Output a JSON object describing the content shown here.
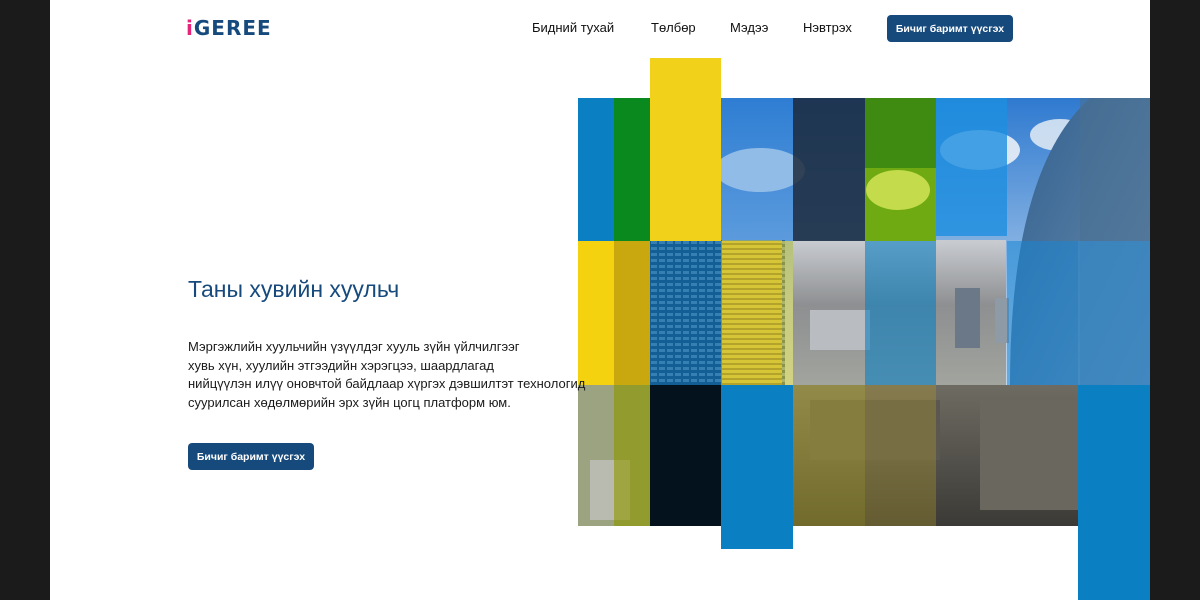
{
  "brand": {
    "logo_prefix": "i",
    "logo_rest": "GEREE"
  },
  "nav": {
    "items": [
      {
        "label": "Бидний тухай"
      },
      {
        "label": "Төлбөр"
      },
      {
        "label": "Мэдээ"
      },
      {
        "label": "Нэвтрэх"
      }
    ],
    "cta_label": "Бичиг баримт үүсгэх"
  },
  "hero": {
    "title": "Таны хувийн хуульч",
    "description_lines": [
      "Мэргэжлийн хуульчийн үзүүлдэг хууль зүйн үйлчилгээг",
      "хувь хүн, хуулийн этгээдийн хэрэгцээ, шаардлагад",
      "нийцүүлэн илүү оновчтой байдлаар хүргэх дэвшилтэт технологид",
      "суурилсан хөдөлмөрийн эрх зүйн цогц платформ юм."
    ],
    "cta_label": "Бичиг баримт үүсгэх"
  },
  "colors": {
    "brand_blue": "#174a7c",
    "logo_pink": "#e4257a",
    "tile_blue": "#0a7fc2",
    "tile_green": "#0a8a1e",
    "tile_yellow": "#f2d11a",
    "tile_dark": "#04121e"
  },
  "collage": {
    "image_description": "Mosaic of city photos tinted blue, green and yellow"
  }
}
